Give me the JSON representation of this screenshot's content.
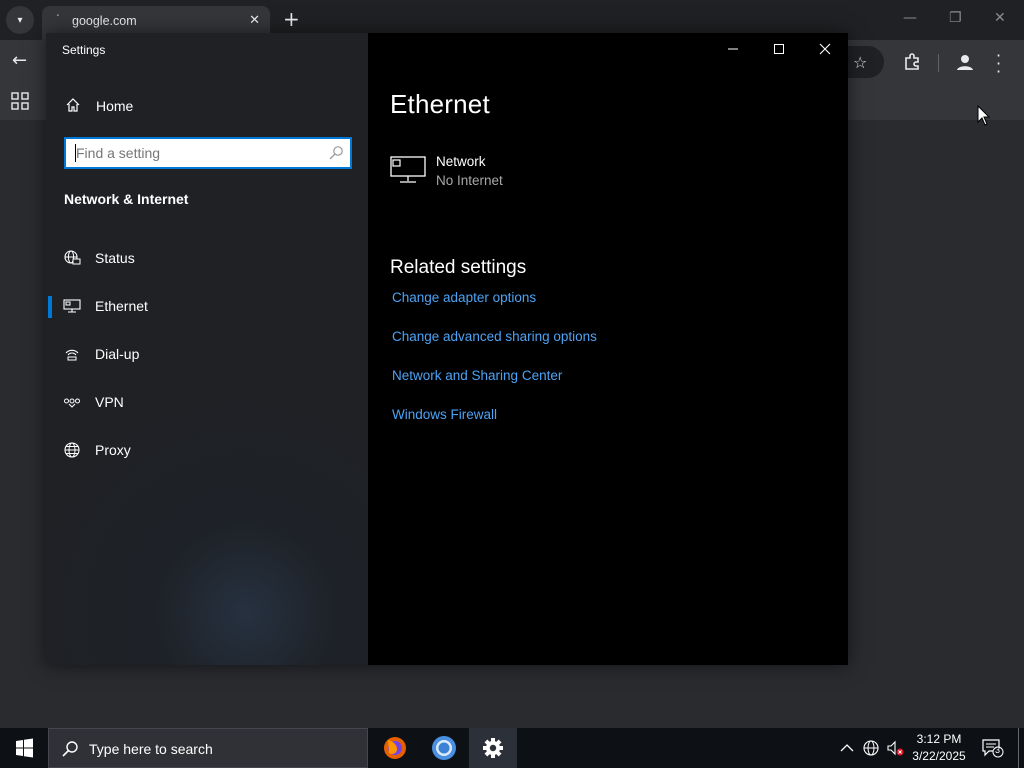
{
  "browser": {
    "tab_title": "google.com",
    "tab_close_glyph": "✕",
    "new_tab_glyph": "+",
    "icons": [
      "tab-search-icon",
      "back-icon",
      "apps-icon",
      "star-icon",
      "extensions-icon",
      "profile-icon",
      "menu-icon"
    ]
  },
  "settings": {
    "window_title": "Settings",
    "home_label": "Home",
    "search": {
      "placeholder": "Find a setting",
      "value": ""
    },
    "section_heading": "Network & Internet",
    "nav_items": [
      {
        "label": "Status",
        "icon": "globe-status-icon",
        "selected": false
      },
      {
        "label": "Ethernet",
        "icon": "ethernet-icon",
        "selected": true
      },
      {
        "label": "Dial-up",
        "icon": "dialup-icon",
        "selected": false
      },
      {
        "label": "VPN",
        "icon": "vpn-icon",
        "selected": false
      },
      {
        "label": "Proxy",
        "icon": "globe-icon",
        "selected": false
      }
    ],
    "page_title": "Ethernet",
    "network": {
      "name": "Network",
      "status": "No Internet"
    },
    "related_heading": "Related settings",
    "related_links": [
      "Change adapter options",
      "Change advanced sharing options",
      "Network and Sharing Center",
      "Windows Firewall"
    ],
    "accent_color": "#0078d7",
    "link_color": "#4ca3f5"
  },
  "taskbar": {
    "search_text": "Type here to search",
    "apps": [
      "firefox-icon",
      "chrome-icon",
      "settings-gear-icon"
    ],
    "time": "3:12 PM",
    "date": "3/22/2025",
    "notification_count": "3"
  }
}
